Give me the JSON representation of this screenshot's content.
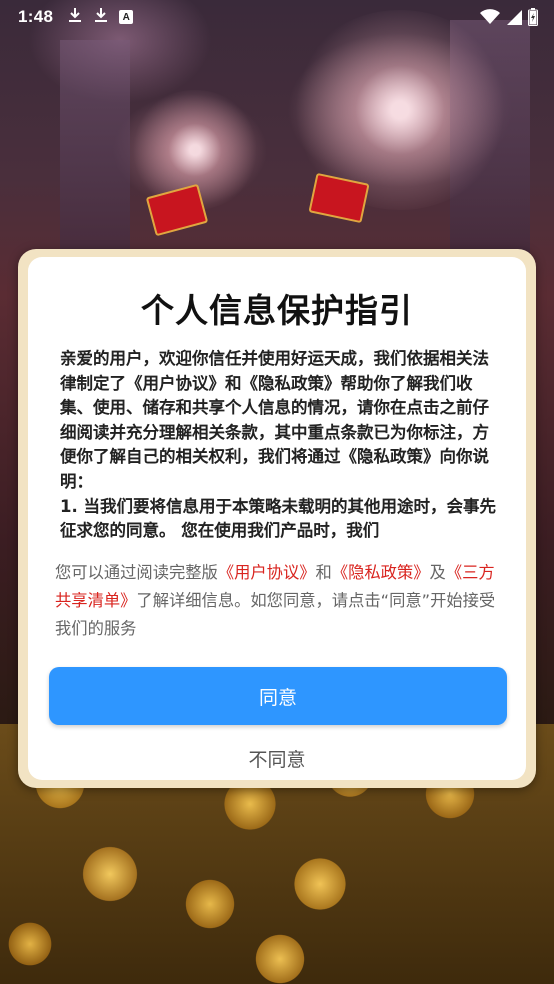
{
  "status_bar": {
    "time": "1:48",
    "notification_icons": [
      "download-icon",
      "download-icon",
      "a-app-icon"
    ],
    "a_icon_letter": "A",
    "right_icons": [
      "wifi-icon",
      "signal-icon",
      "battery-charging-icon"
    ]
  },
  "dialog": {
    "title": "个人信息保护指引",
    "body": "亲爱的用户，欢迎你信任并使用好运天成，我们依据相关法律制定了《用户协议》和《隐私政策》帮助你了解我们收集、使用、储存和共享个人信息的情况，请你在点击之前仔细阅读并充分理解相关条款，其中重点条款已为你标注，方便你了解自己的相关权利，我们将通过《隐私政策》向你说明：\n1. 当我们要将信息用于本策略未载明的其他用途时，会事先征求您的同意。 您在使用我们产品时，我们",
    "notice": {
      "prefix": "您可以通过阅读完整版",
      "link_user_agreement": "《用户协议》",
      "and": "和",
      "link_privacy_policy": "《隐私政策》",
      "and2": "及",
      "link_third_party": "《三方共享清单》",
      "suffix": "了解详细信息。如您同意，请点击“同意”开始接受我们的服务"
    },
    "agree_label": "同意",
    "disagree_label": "不同意"
  },
  "colors": {
    "accent": "#2e96ff",
    "link": "#d9241f",
    "frame": "#f2e3c3"
  }
}
